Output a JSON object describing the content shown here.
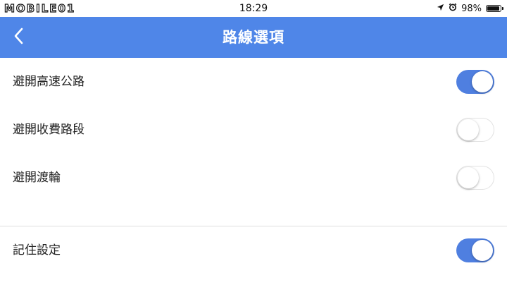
{
  "status_bar": {
    "watermark": "MOBILE01",
    "time": "18:29",
    "battery_percent": "98%",
    "battery_level": 0.98,
    "icons": [
      "location-arrow-icon",
      "alarm-clock-icon",
      "battery-icon"
    ]
  },
  "header": {
    "title": "路線選項",
    "back_icon": "chevron-left-icon",
    "background_color": "#4f86e8"
  },
  "options": [
    {
      "label": "避開高速公路",
      "enabled": true
    },
    {
      "label": "避開收費路段",
      "enabled": false
    },
    {
      "label": "避開渡輪",
      "enabled": false
    }
  ],
  "remember": {
    "label": "記住設定",
    "enabled": true
  },
  "colors": {
    "toggle_on": "#4f7fe0",
    "toggle_off": "#ffffff"
  }
}
